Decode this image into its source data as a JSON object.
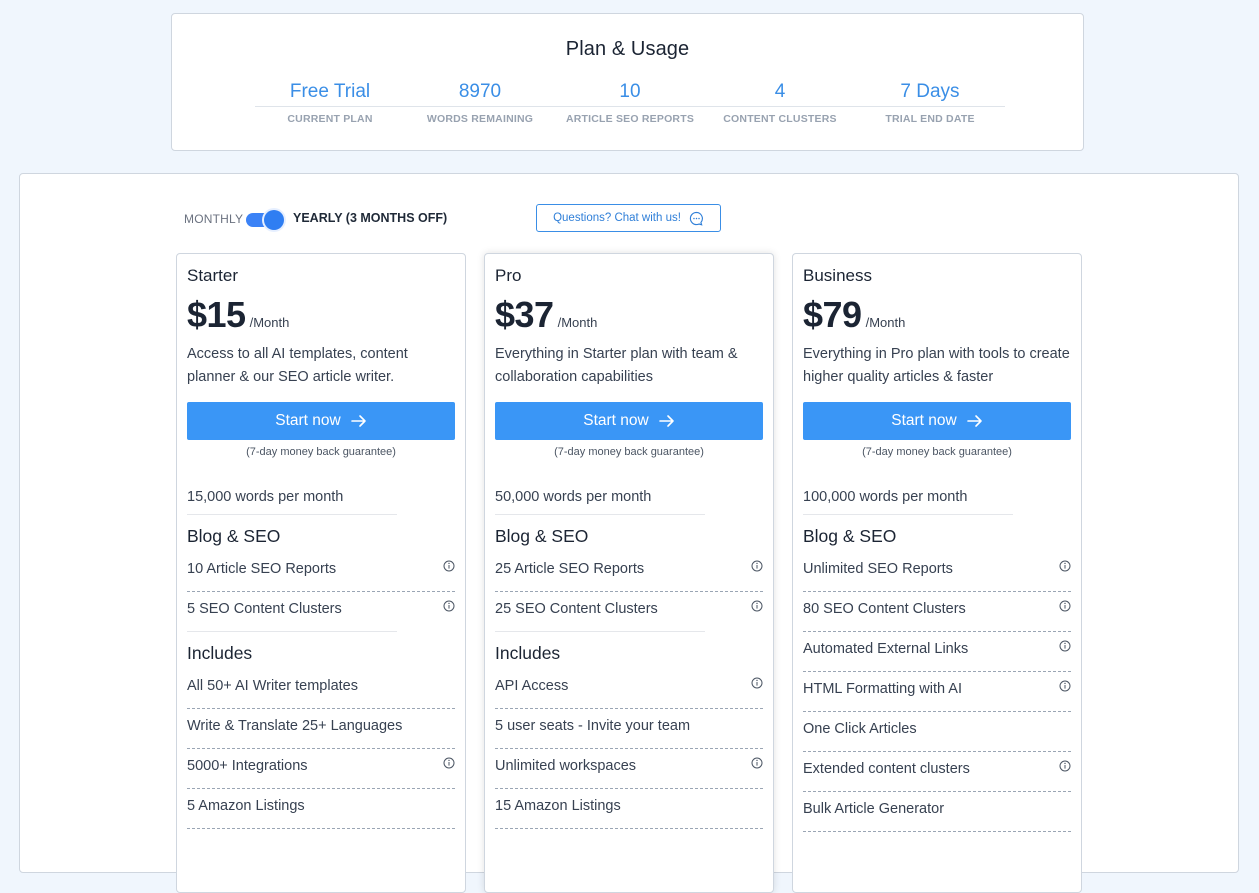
{
  "usage": {
    "title": "Plan & Usage",
    "stats": [
      {
        "value": "Free Trial",
        "label": "CURRENT PLAN"
      },
      {
        "value": "8970",
        "label": "WORDS REMAINING"
      },
      {
        "value": "10",
        "label": "ARTICLE SEO REPORTS"
      },
      {
        "value": "4",
        "label": "CONTENT CLUSTERS"
      },
      {
        "value": "7 Days",
        "label": "TRIAL END DATE"
      }
    ]
  },
  "billing": {
    "monthly_label": "MONTHLY",
    "yearly_label": "YEARLY (3 MONTHS OFF)",
    "yearly_selected": true,
    "chat_label": "Questions? Chat with us!"
  },
  "colors": {
    "accent": "#3a96f6",
    "link": "#3a8ee6"
  },
  "plans": [
    {
      "name": "Starter",
      "price": "$15",
      "period": "/Month",
      "description": "Access to all AI templates, content planner & our SEO article writer.",
      "cta": "Start now",
      "guarantee": "(7-day money back guarantee)",
      "words": "15,000 words per month",
      "blog_title": "Blog & SEO",
      "blog_features": [
        {
          "text": "10 Article SEO Reports",
          "info": true
        },
        {
          "text": "5 SEO Content Clusters",
          "info": true
        }
      ],
      "includes_title": "Includes",
      "includes": [
        {
          "text": "All 50+ AI Writer templates",
          "info": false
        },
        {
          "text": "Write & Translate 25+ Languages",
          "info": false
        },
        {
          "text": "5000+ Integrations",
          "info": true
        },
        {
          "text": "5 Amazon Listings",
          "info": false
        }
      ]
    },
    {
      "name": "Pro",
      "price": "$37",
      "period": "/Month",
      "description": "Everything in Starter plan with team & collaboration capabilities",
      "cta": "Start now",
      "guarantee": "(7-day money back guarantee)",
      "words": "50,000 words per month",
      "blog_title": "Blog & SEO",
      "blog_features": [
        {
          "text": "25 Article SEO Reports",
          "info": true
        },
        {
          "text": "25 SEO Content Clusters",
          "info": true
        }
      ],
      "includes_title": "Includes",
      "includes": [
        {
          "text": "API Access",
          "info": true
        },
        {
          "text": "5 user seats - Invite your team",
          "info": false
        },
        {
          "text": "Unlimited workspaces",
          "info": true
        },
        {
          "text": "15 Amazon Listings",
          "info": false
        }
      ]
    },
    {
      "name": "Business",
      "price": "$79",
      "period": "/Month",
      "description": "Everything in Pro plan with tools to create higher quality articles & faster",
      "cta": "Start now",
      "guarantee": "(7-day money back guarantee)",
      "words": "100,000 words per month",
      "blog_title": "Blog & SEO",
      "blog_features": [
        {
          "text": "Unlimited SEO Reports",
          "info": true
        },
        {
          "text": "80 SEO Content Clusters",
          "info": true
        },
        {
          "text": "Automated External Links",
          "info": true
        },
        {
          "text": "HTML Formatting with AI",
          "info": true
        },
        {
          "text": "One Click Articles",
          "info": false
        },
        {
          "text": "Extended content clusters",
          "info": true
        },
        {
          "text": "Bulk Article Generator",
          "info": false
        }
      ],
      "includes_title": "",
      "includes": []
    }
  ]
}
